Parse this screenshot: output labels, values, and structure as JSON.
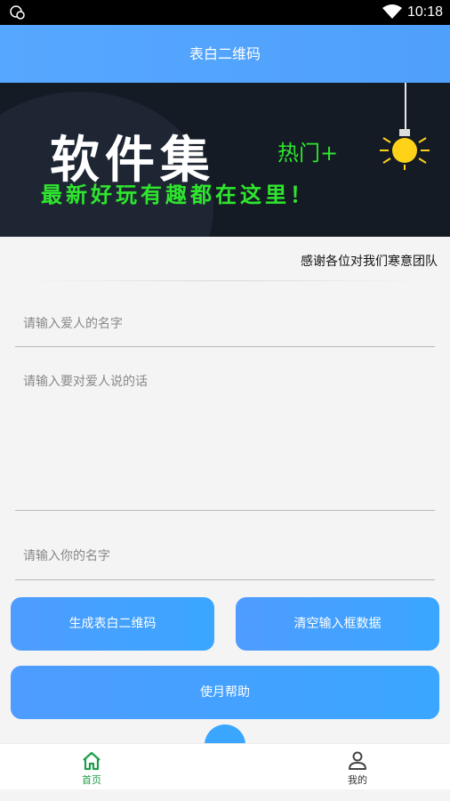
{
  "status_bar": {
    "time": "10:18"
  },
  "app": {
    "title": "表白二维码"
  },
  "banner": {
    "title": "软件集",
    "hot_tag": "热门+",
    "subtitle": "最新好玩有趣都在这里！"
  },
  "marquee": {
    "text": "感谢各位对我们寒意团队"
  },
  "form": {
    "lover_name": {
      "placeholder": "请输入爱人的名字",
      "value": ""
    },
    "message": {
      "placeholder": "请输入要对爱人说的话",
      "value": ""
    },
    "your_name": {
      "placeholder": "请输入你的名字",
      "value": ""
    }
  },
  "buttons": {
    "generate": "生成表白二维码",
    "clear": "清空输入框数据",
    "help": "使月帮助"
  },
  "tabs": [
    {
      "label": "首页",
      "icon": "home-icon",
      "active": true
    },
    {
      "label": "我的",
      "icon": "person-icon",
      "active": false
    }
  ],
  "colors": {
    "accent": "#4fa0fa",
    "active_tab": "#1e9e4a",
    "banner_green": "#2ee62e"
  }
}
